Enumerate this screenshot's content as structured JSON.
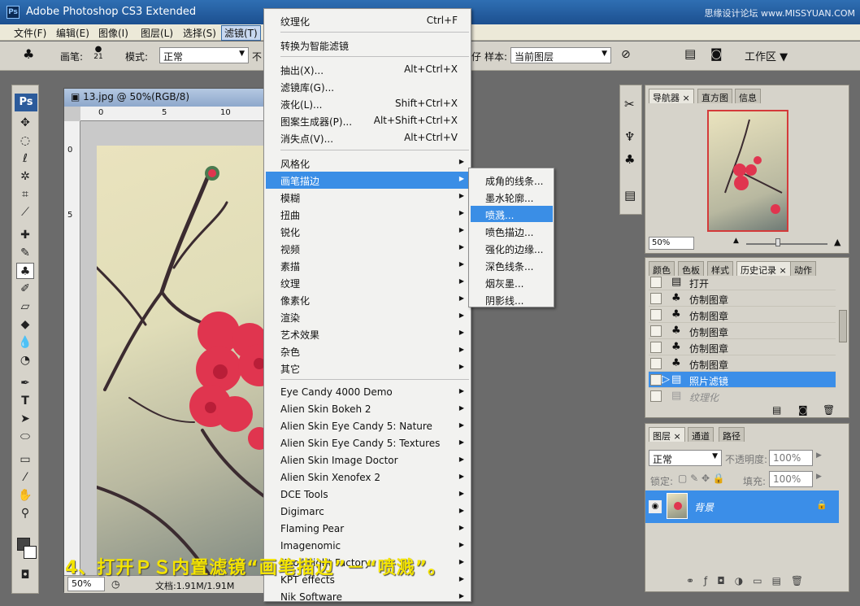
{
  "window": {
    "title": "Adobe Photoshop CS3 Extended",
    "app_icon": "Ps",
    "watermark": "思缘设计论坛 www.MISSYUAN.COM"
  },
  "menubar": [
    "文件(F)",
    "编辑(E)",
    "图像(I)",
    "图层(L)",
    "选择(S)",
    "滤镜(T)"
  ],
  "options": {
    "brush_label": "画笔:",
    "brush_size": "21",
    "mode_label": "模式:",
    "mode_value": "正常",
    "opacity_label": "不",
    "sample_cut": "仔",
    "sample_label": "样本:",
    "sample_value": "当前图层",
    "workspace": "工作区"
  },
  "toolbox": {
    "logo": "Ps"
  },
  "document": {
    "title": "13.jpg @ 50%(RGB/8)",
    "ruler_h": [
      "0",
      "5",
      "10"
    ],
    "ruler_v": [
      "0",
      "5"
    ],
    "zoom": "50%",
    "doc_size": "文档:1.91M/1.91M"
  },
  "navigator": {
    "tabs": [
      "导航器",
      "直方图",
      "信息"
    ],
    "zoom": "50%"
  },
  "history": {
    "tabs": [
      "颜色",
      "色板",
      "样式",
      "历史记录",
      "动作"
    ],
    "items": [
      {
        "label": "打开",
        "icon": "document-icon"
      },
      {
        "label": "仿制图章",
        "icon": "stamp-icon"
      },
      {
        "label": "仿制图章",
        "icon": "stamp-icon"
      },
      {
        "label": "仿制图章",
        "icon": "stamp-icon"
      },
      {
        "label": "仿制图章",
        "icon": "stamp-icon"
      },
      {
        "label": "仿制图章",
        "icon": "stamp-icon"
      },
      {
        "label": "照片滤镜",
        "icon": "document-icon"
      },
      {
        "label": "纹理化",
        "icon": "document-icon"
      }
    ],
    "selected_index": 6
  },
  "layers": {
    "tabs": [
      "图层",
      "通道",
      "路径"
    ],
    "blend": "正常",
    "opacity_label": "不透明度:",
    "opacity": "100%",
    "lock_label": "锁定:",
    "fill_label": "填充:",
    "fill": "100%",
    "layer_name": "背景"
  },
  "filter_menu": {
    "top": [
      {
        "label": "纹理化",
        "shortcut": "Ctrl+F"
      }
    ],
    "smart": [
      {
        "label": "转换为智能滤镜",
        "shortcut": ""
      }
    ],
    "group1": [
      {
        "label": "抽出(X)...",
        "shortcut": "Alt+Ctrl+X"
      },
      {
        "label": "滤镜库(G)...",
        "shortcut": ""
      },
      {
        "label": "液化(L)...",
        "shortcut": "Shift+Ctrl+X"
      },
      {
        "label": "图案生成器(P)...",
        "shortcut": "Alt+Shift+Ctrl+X"
      },
      {
        "label": "消失点(V)...",
        "shortcut": "Alt+Ctrl+V"
      }
    ],
    "group2": [
      "风格化",
      "画笔描边",
      "模糊",
      "扭曲",
      "锐化",
      "视频",
      "素描",
      "纹理",
      "像素化",
      "渲染",
      "艺术效果",
      "杂色",
      "其它"
    ],
    "highlighted": "画笔描边",
    "group3": [
      "Eye Candy 4000  Demo",
      "Alien Skin Bokeh 2",
      "Alien Skin Eye Candy 5: Nature",
      "Alien Skin Eye Candy 5: Textures",
      "Alien Skin Image Doctor",
      "Alien Skin Xenofex 2",
      "DCE Tools",
      "Digimarc",
      "Flaming Pear",
      "Imagenomic",
      "Knoll Light Factory",
      "KPT effects",
      "Nik Software"
    ]
  },
  "submenu": {
    "items": [
      "成角的线条...",
      "墨水轮廓...",
      "喷溅...",
      "喷色描边...",
      "强化的边缘...",
      "深色线条...",
      "烟灰墨...",
      "阴影线..."
    ],
    "highlighted": "喷溅..."
  },
  "caption": "4、打开ＰＳ内置滤镜“画笔描边”－“喷溅”。",
  "colors": {
    "highlight": "#3a8ee6",
    "caption": "#f3e300",
    "blossom": "#e0354f"
  }
}
